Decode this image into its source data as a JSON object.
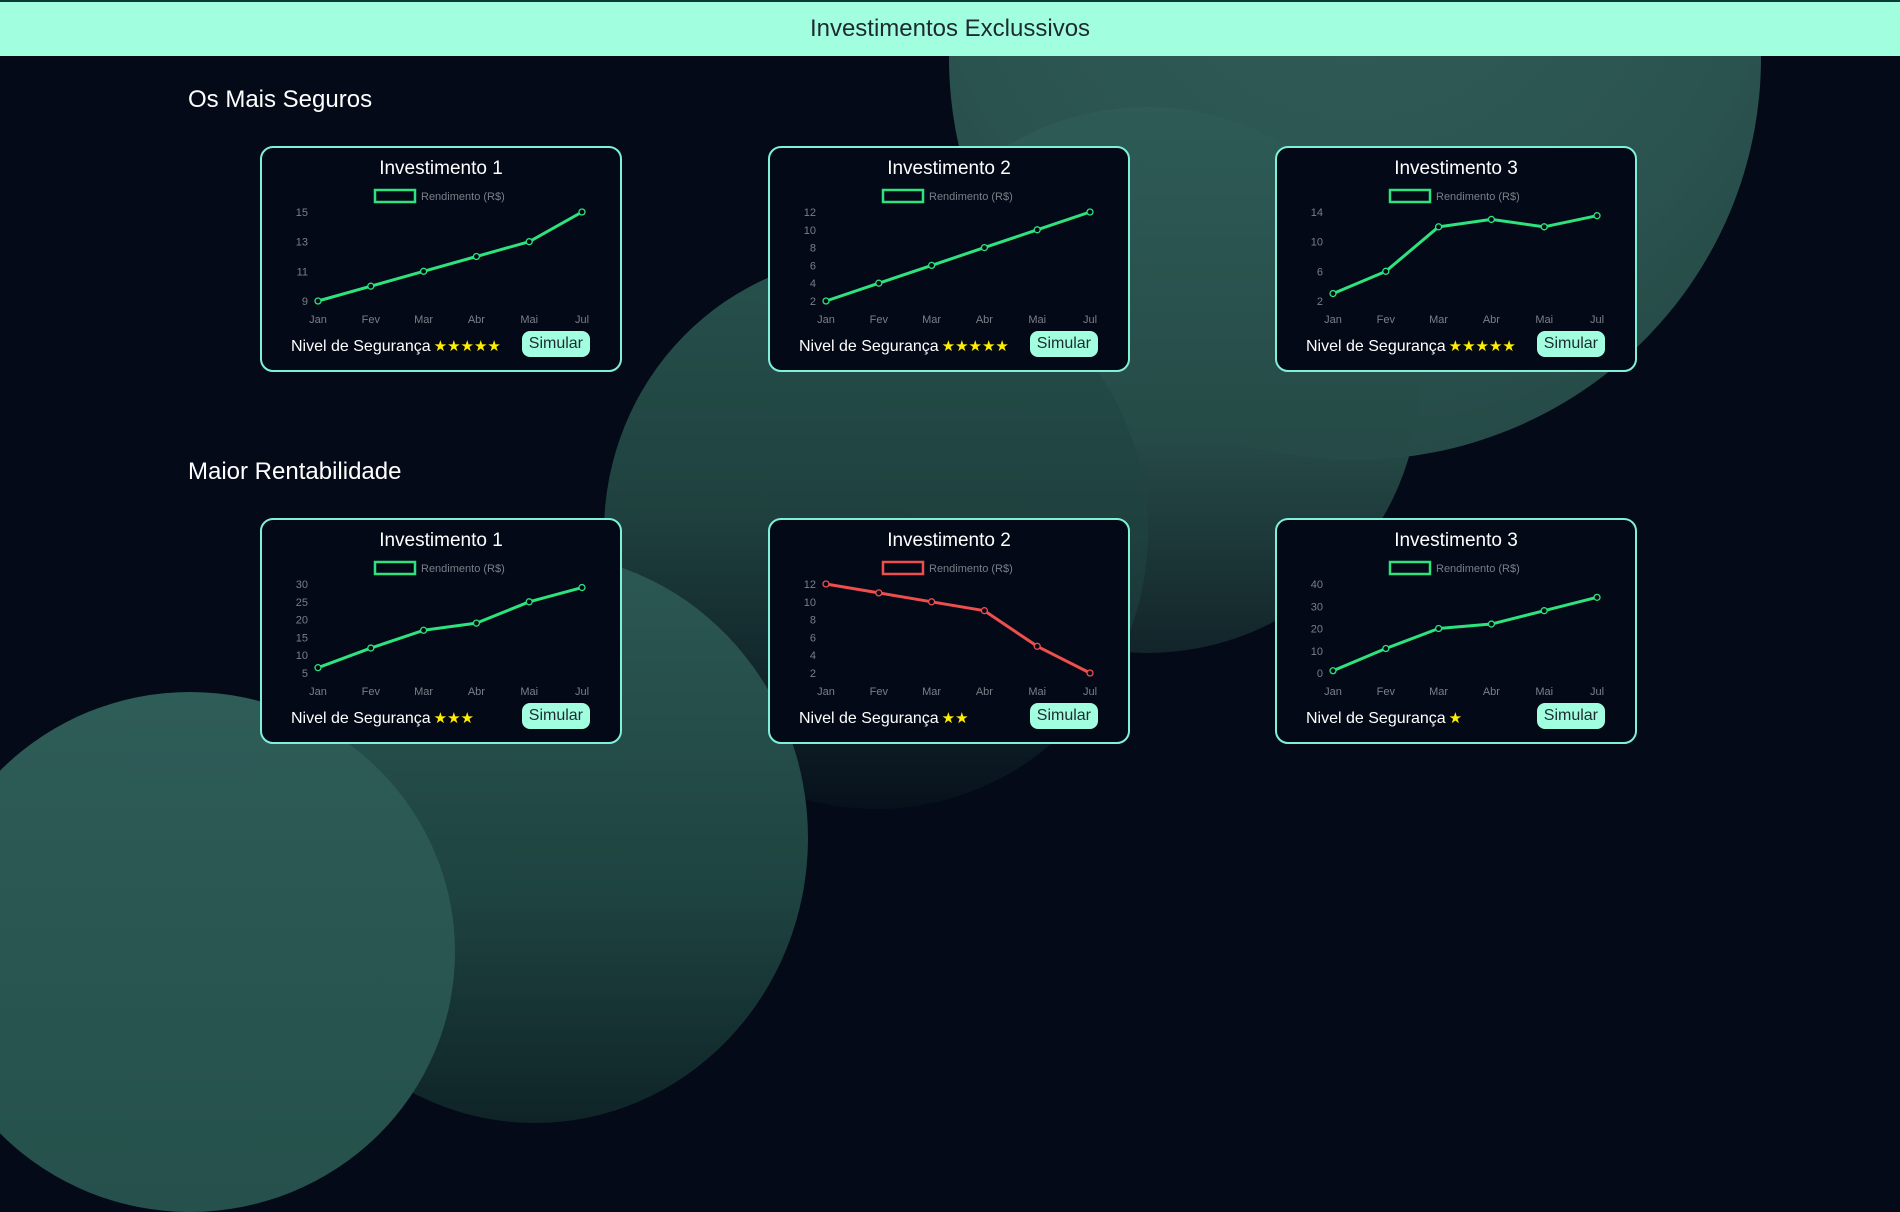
{
  "header": {
    "title": "Investimentos Exclussivos"
  },
  "sections": [
    {
      "title": "Os Mais Seguros",
      "cards": [
        {
          "title": "Investimento 1",
          "safety_label": "Nivel de Segurança",
          "stars": "★★★★★",
          "button_label": "Simular"
        },
        {
          "title": "Investimento 2",
          "safety_label": "Nivel de Segurança",
          "stars": "★★★★★",
          "button_label": "Simular"
        },
        {
          "title": "Investimento 3",
          "safety_label": "Nivel de Segurança",
          "stars": "★★★★★",
          "button_label": "Simular"
        }
      ]
    },
    {
      "title": "Maior Rentabilidade",
      "cards": [
        {
          "title": "Investimento 1",
          "safety_label": "Nivel de Segurança",
          "stars": "★★★",
          "button_label": "Simular"
        },
        {
          "title": "Investimento 2",
          "safety_label": "Nivel de Segurança",
          "stars": "★★",
          "button_label": "Simular"
        },
        {
          "title": "Investimento 3",
          "safety_label": "Nivel de Segurança",
          "stars": "★",
          "button_label": "Simular"
        }
      ]
    }
  ],
  "chart_data": [
    {
      "type": "line",
      "x": [
        "Jan",
        "Fev",
        "Mar",
        "Abr",
        "Mai",
        "Jul"
      ],
      "yticks": [
        9,
        11,
        13,
        15
      ],
      "ylim": [
        9,
        15
      ],
      "series": [
        {
          "name": "Rendimento (R$)",
          "color": "#2ee27e",
          "values": [
            9,
            10,
            11,
            12,
            13,
            15
          ]
        }
      ],
      "legend": "top"
    },
    {
      "type": "line",
      "x": [
        "Jan",
        "Fev",
        "Mar",
        "Abr",
        "Mai",
        "Jul"
      ],
      "yticks": [
        2,
        4,
        6,
        8,
        10,
        12
      ],
      "ylim": [
        2,
        12
      ],
      "series": [
        {
          "name": "Rendimento (R$)",
          "color": "#2ee27e",
          "values": [
            2,
            4,
            6,
            8,
            10,
            12
          ]
        }
      ],
      "legend": "top"
    },
    {
      "type": "line",
      "x": [
        "Jan",
        "Fev",
        "Mar",
        "Abr",
        "Mai",
        "Jul"
      ],
      "yticks": [
        2,
        6,
        10,
        14
      ],
      "ylim": [
        2,
        14
      ],
      "series": [
        {
          "name": "Rendimento (R$)",
          "color": "#2ee27e",
          "values": [
            3,
            6,
            12,
            13,
            12,
            13.5
          ]
        }
      ],
      "legend": "top"
    },
    {
      "type": "line",
      "x": [
        "Jan",
        "Fev",
        "Mar",
        "Abr",
        "Mai",
        "Jul"
      ],
      "yticks": [
        5,
        10,
        15,
        20,
        25,
        30
      ],
      "ylim": [
        5,
        30
      ],
      "series": [
        {
          "name": "Rendimento (R$)",
          "color": "#2ee27e",
          "values": [
            6.5,
            12,
            17,
            19,
            25,
            29
          ]
        }
      ],
      "legend": "top"
    },
    {
      "type": "line",
      "x": [
        "Jan",
        "Fev",
        "Mar",
        "Abr",
        "Mai",
        "Jul"
      ],
      "yticks": [
        2,
        4,
        6,
        8,
        10,
        12
      ],
      "ylim": [
        2,
        12
      ],
      "series": [
        {
          "name": "Rendimento (R$)",
          "color": "#ee4e4e",
          "values": [
            12,
            11,
            10,
            9,
            5,
            2
          ]
        }
      ],
      "legend": "top"
    },
    {
      "type": "line",
      "x": [
        "Jan",
        "Fev",
        "Mar",
        "Abr",
        "Mai",
        "Jul"
      ],
      "yticks": [
        0,
        10,
        20,
        30,
        40
      ],
      "ylim": [
        0,
        40
      ],
      "series": [
        {
          "name": "Rendimento (R$)",
          "color": "#2ee27e",
          "values": [
            1,
            11,
            20,
            22,
            28,
            34
          ]
        }
      ],
      "legend": "top"
    }
  ]
}
